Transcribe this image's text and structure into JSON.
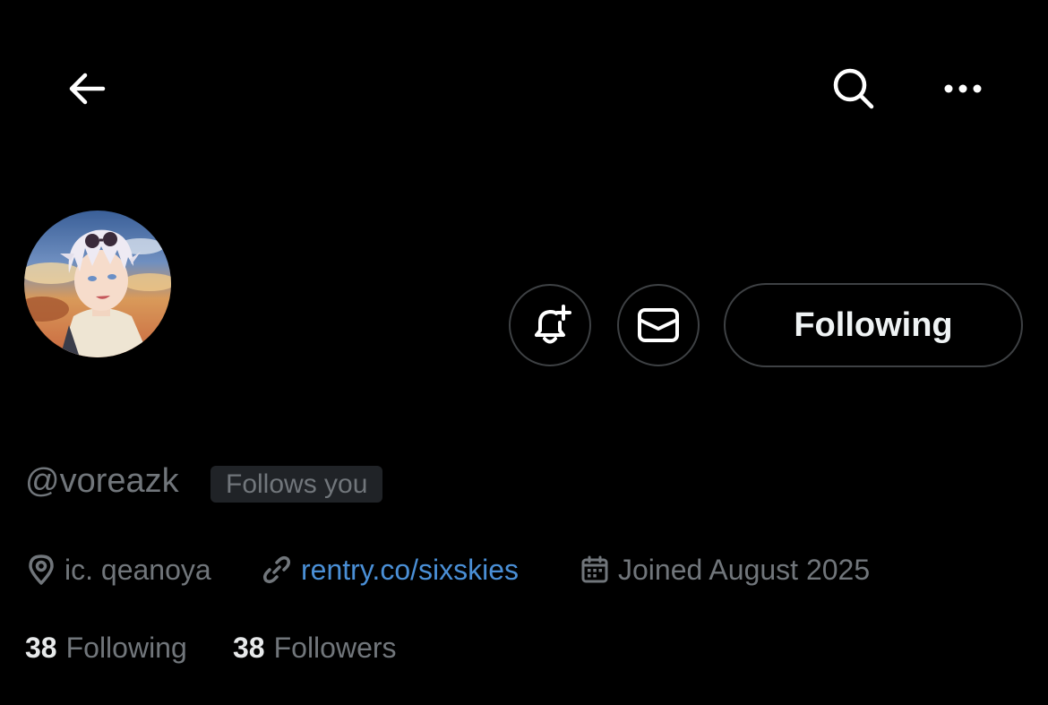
{
  "top_bar": {
    "back_icon": "arrow-left-icon",
    "search_icon": "search-icon",
    "more_icon": "more-horizontal-icon"
  },
  "profile": {
    "avatar": "anime-avatar-image",
    "handle": "@voreazk",
    "follows_you_label": "Follows you",
    "location": "ic. qeanoya",
    "website": "rentry.co/sixskies",
    "joined": "Joined August 2025"
  },
  "actions": {
    "notify_icon": "bell-plus-icon",
    "message_icon": "envelope-icon",
    "following_label": "Following"
  },
  "stats": {
    "following_count": "38",
    "following_label": "Following",
    "followers_count": "38",
    "followers_label": "Followers"
  },
  "colors": {
    "background": "#000000",
    "text_primary": "#e7e9ea",
    "text_secondary": "#71767b",
    "link": "#4a8fd6",
    "border": "#3e4144",
    "badge_bg": "#202327"
  }
}
